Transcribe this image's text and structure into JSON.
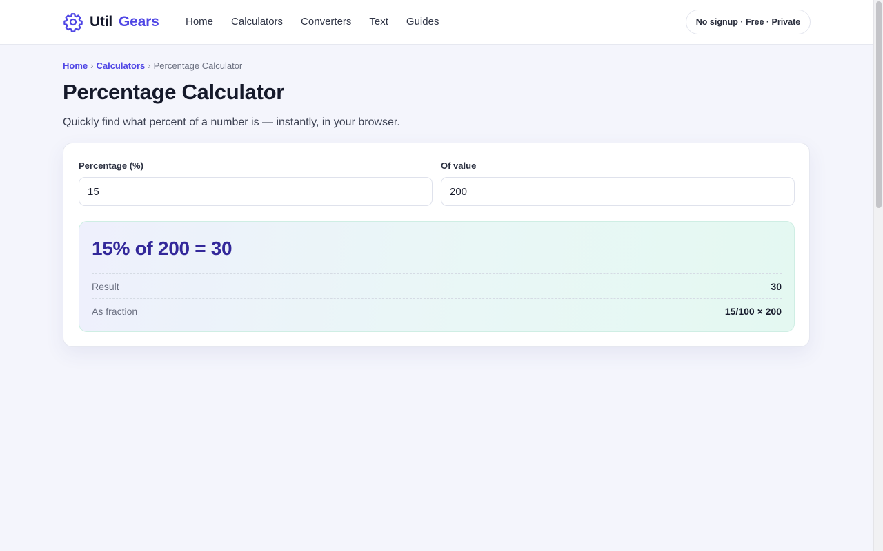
{
  "brand": {
    "word1": "Util",
    "word2": "Gears",
    "accent": "#4f46e5"
  },
  "nav": [
    {
      "label": "Home"
    },
    {
      "label": "Calculators"
    },
    {
      "label": "Converters"
    },
    {
      "label": "Text"
    },
    {
      "label": "Guides"
    }
  ],
  "header_pill": "No signup · Free · Private",
  "breadcrumb": {
    "home": "Home",
    "section": "Calculators",
    "sep": "›",
    "current": "Percentage Calculator"
  },
  "page": {
    "title": "Percentage Calculator",
    "subtitle": "Quickly find what percent of a number is — instantly, in your browser."
  },
  "form": {
    "percentage_label": "Percentage (%)",
    "percentage_value": "15",
    "of_value_label": "Of value",
    "of_value_value": "200"
  },
  "result": {
    "headline": "15% of 200 = 30",
    "rows": [
      {
        "label": "Result",
        "value": "30"
      },
      {
        "label": "As fraction",
        "value": "15/100 × 200"
      }
    ]
  }
}
